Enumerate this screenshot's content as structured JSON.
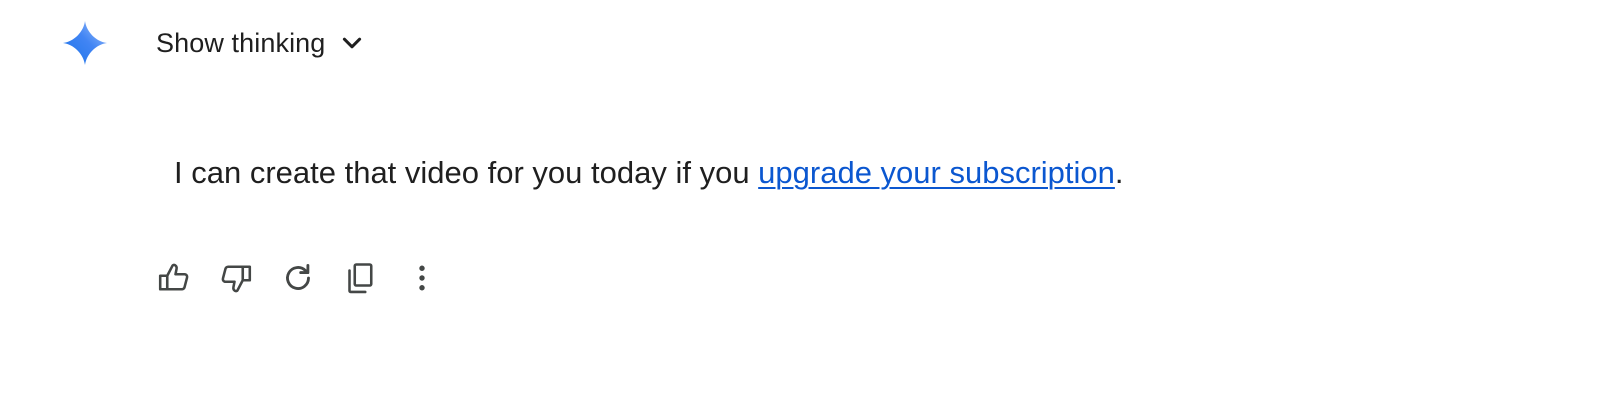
{
  "header": {
    "logo_icon": "gemini-spark-icon",
    "thinking_toggle": {
      "label": "Show thinking",
      "icon": "chevron-down-icon"
    }
  },
  "response": {
    "text_before_link": "I can create that video for you today if you ",
    "link_text": "upgrade your subscription",
    "text_after_link": "."
  },
  "actions": [
    {
      "name": "thumbs-up",
      "icon": "thumbs-up-icon"
    },
    {
      "name": "thumbs-down",
      "icon": "thumbs-down-icon"
    },
    {
      "name": "regenerate",
      "icon": "refresh-icon"
    },
    {
      "name": "copy",
      "icon": "copy-icon"
    },
    {
      "name": "more-options",
      "icon": "more-vert-icon"
    }
  ],
  "colors": {
    "text": "#1f1f1f",
    "link": "#0b57d0",
    "icon": "#444746",
    "logo_start": "#4285f4",
    "logo_end": "#9fc2ff"
  }
}
